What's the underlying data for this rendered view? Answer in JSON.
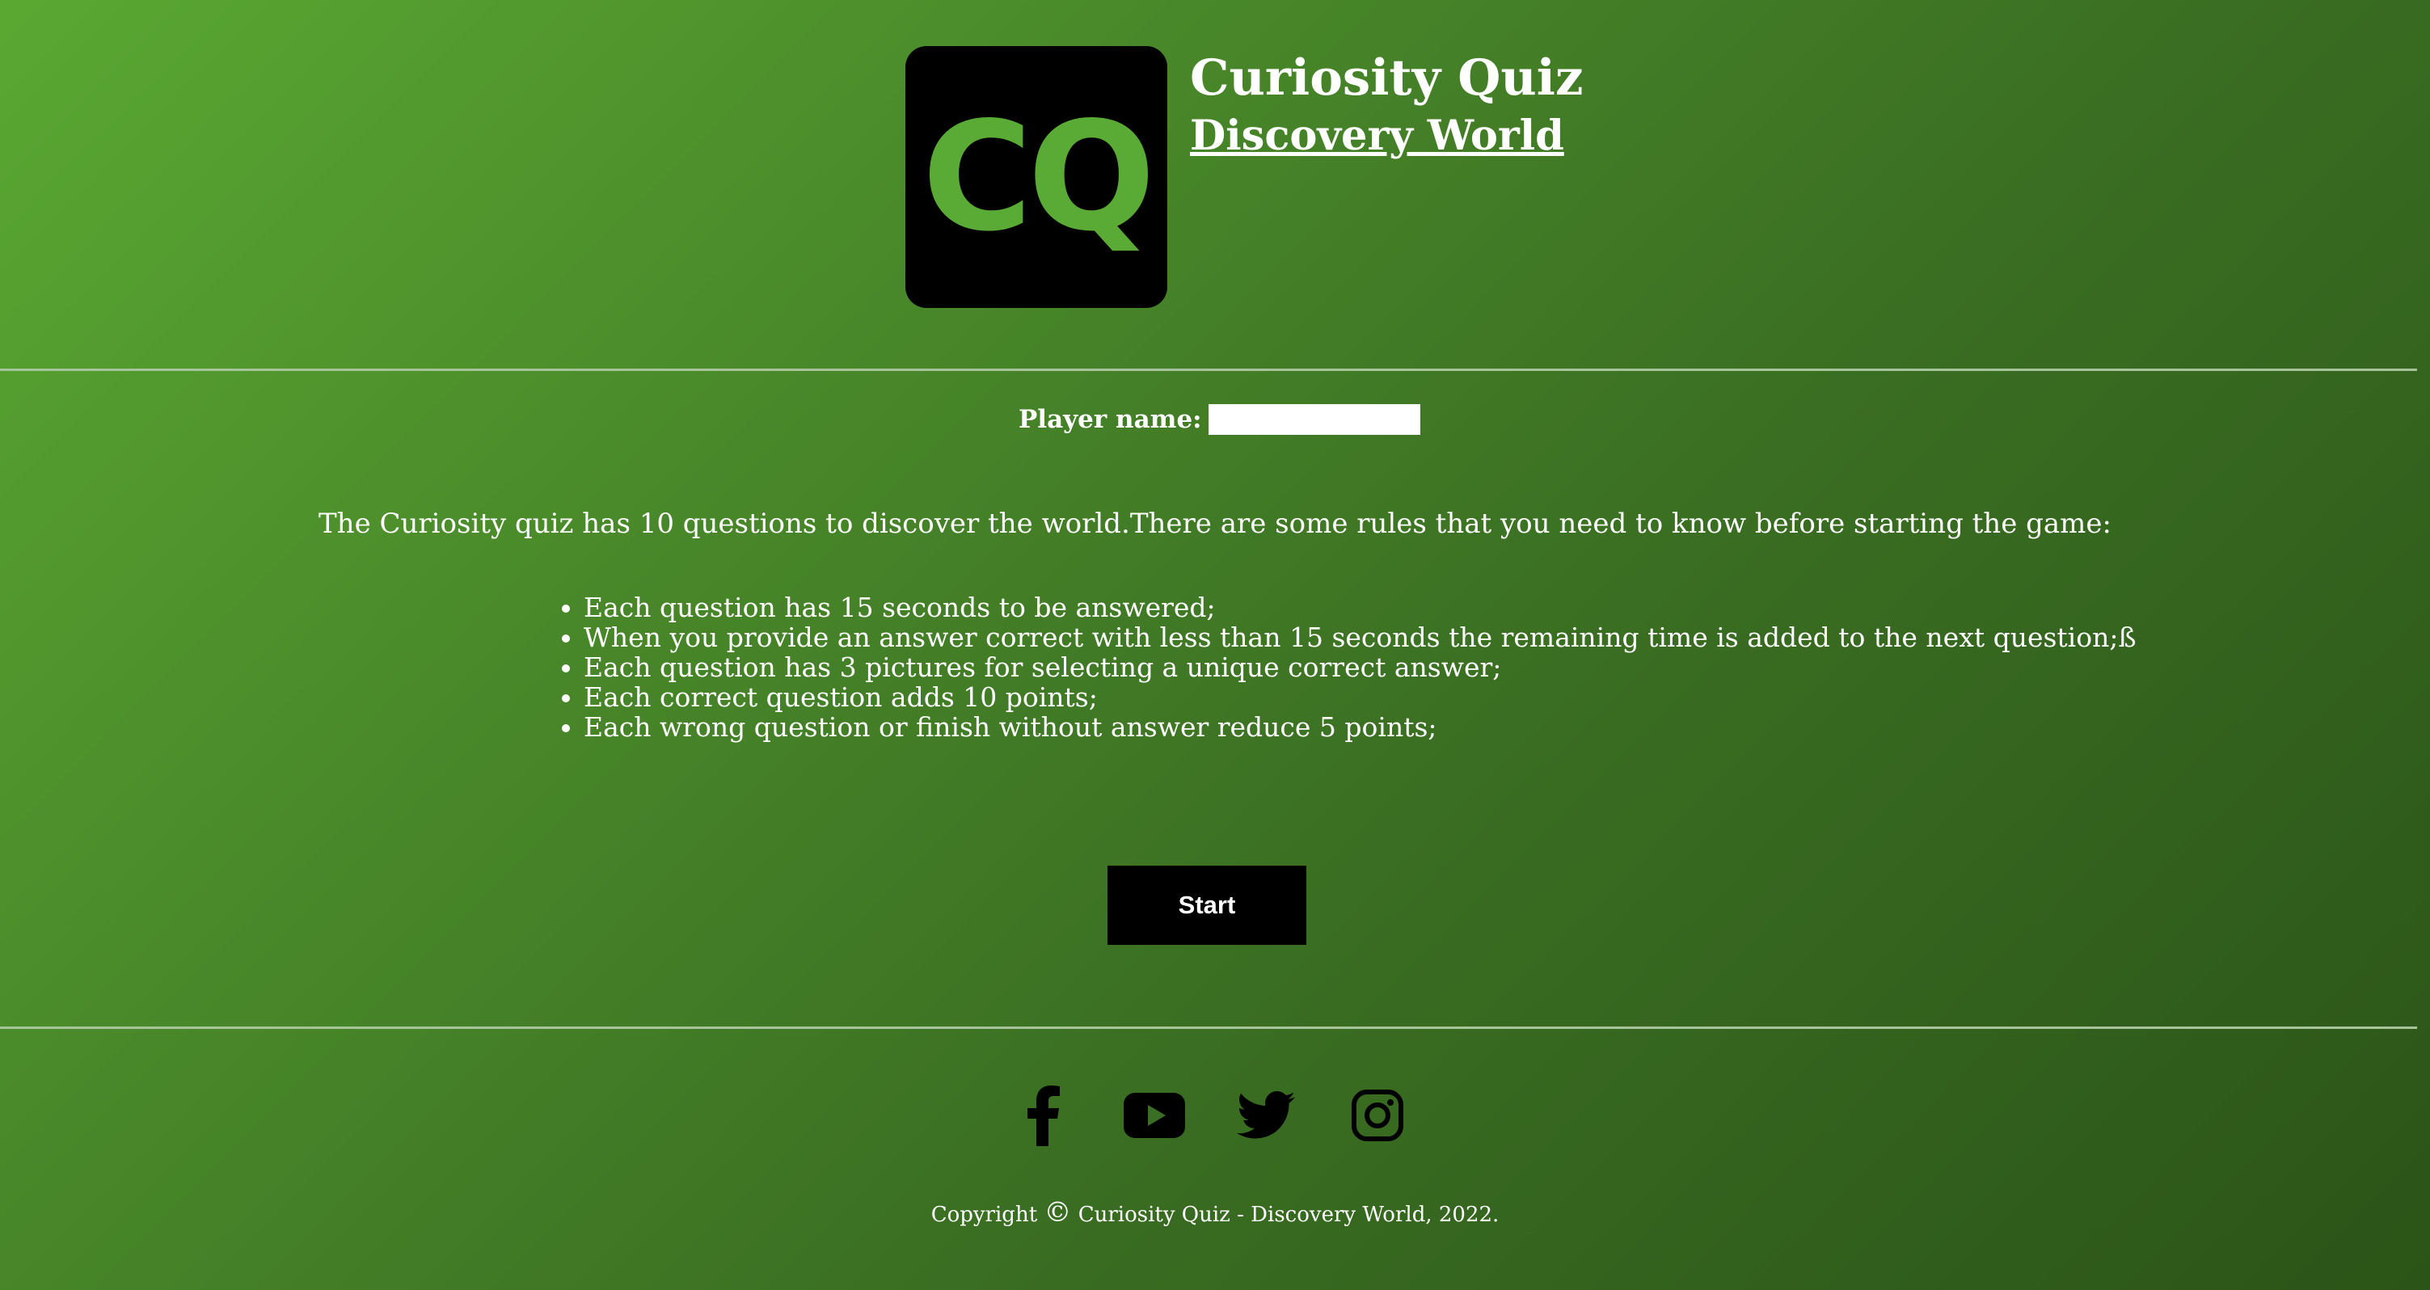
{
  "header": {
    "logo_text": "CQ",
    "title": "Curiosity Quiz",
    "subtitle": "Discovery World"
  },
  "player": {
    "label": "Player name:",
    "value": ""
  },
  "intro": "The Curiosity quiz has 10 questions to discover the world.There are some rules that you need to know before starting the game:",
  "rules": [
    "Each question has 15 seconds to be answered;",
    "When you provide an answer correct with less than 15 seconds the remaining time is added to the next question;ß",
    "Each question has 3 pictures for selecting a unique correct answer;",
    "Each correct question adds 10 points;",
    "Each wrong question or finish without answer reduce 5 points;"
  ],
  "start_label": "Start",
  "social": [
    "facebook-icon",
    "youtube-icon",
    "twitter-icon",
    "instagram-icon"
  ],
  "footer": {
    "prefix": "Copyright",
    "symbol": "©",
    "text": "Curiosity Quiz - Discovery World, 2022."
  },
  "colors": {
    "logo_green": "#5aab36",
    "background_start": "#5aa832",
    "background_end": "#2b5418"
  }
}
